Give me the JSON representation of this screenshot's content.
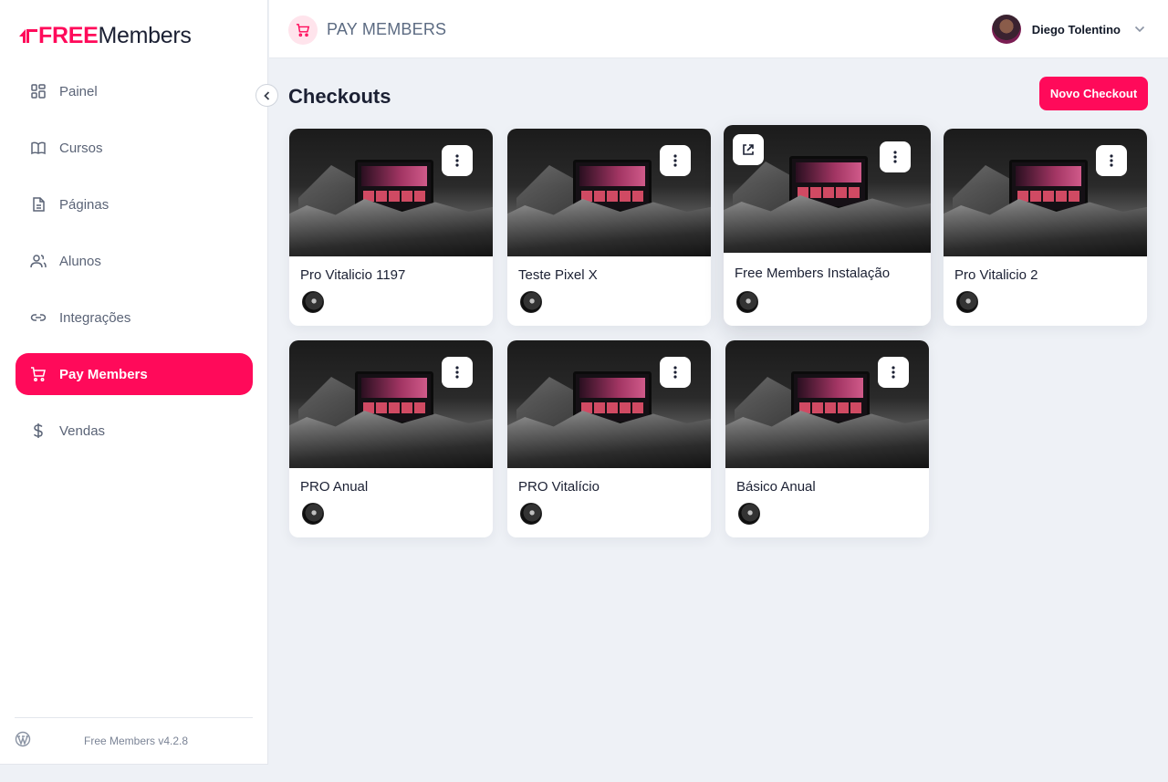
{
  "app": {
    "logo_free": "FREE",
    "logo_members": "Members",
    "version": "Free Members v4.2.8",
    "accent_color": "#ff0a5a"
  },
  "sidebar": {
    "items": [
      {
        "label": "Painel",
        "icon": "dashboard-icon",
        "active": false
      },
      {
        "label": "Cursos",
        "icon": "book-icon",
        "active": false
      },
      {
        "label": "Páginas",
        "icon": "page-icon",
        "active": false
      },
      {
        "label": "Alunos",
        "icon": "users-icon",
        "active": false
      },
      {
        "label": "Integrações",
        "icon": "link-icon",
        "active": false
      },
      {
        "label": "Pay Members",
        "icon": "cart-icon",
        "active": true
      },
      {
        "label": "Vendas",
        "icon": "dollar-icon",
        "active": false
      }
    ]
  },
  "header": {
    "section_title": "PAY MEMBERS",
    "user_name": "Diego Tolentino"
  },
  "main": {
    "title": "Checkouts",
    "new_button_label": "Novo Checkout",
    "cards": [
      {
        "title": "Pro Vitalicio 1197"
      },
      {
        "title": "Teste Pixel X"
      },
      {
        "title": "Free Members Instalação"
      },
      {
        "title": "Pro Vitalicio 2"
      },
      {
        "title": "PRO Anual"
      },
      {
        "title": "PRO Vitalício"
      },
      {
        "title": "Básico Anual"
      }
    ]
  }
}
